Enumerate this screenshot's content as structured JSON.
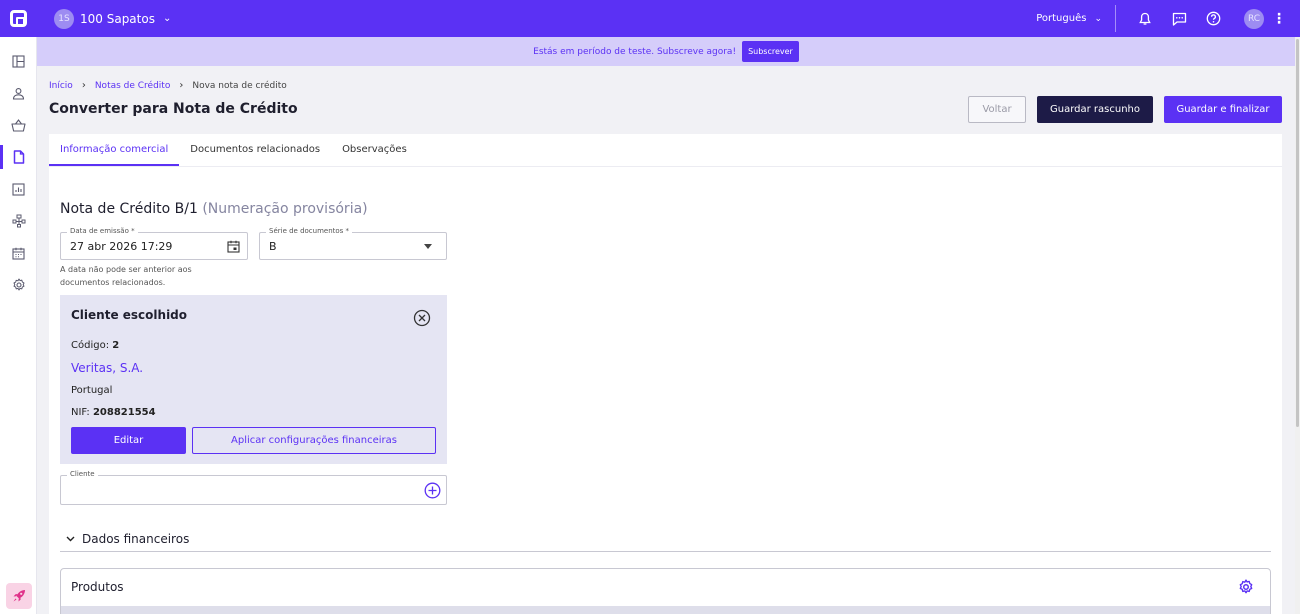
{
  "topbar": {
    "company_initials": "1S",
    "company_name": "100 Sapatos",
    "language": "Português",
    "user_initials": "RC"
  },
  "banner": {
    "text": "Estás em período de teste. Subscreve agora!",
    "button": "Subscrever"
  },
  "breadcrumb": {
    "home": "Início",
    "parent": "Notas de Crédito",
    "current": "Nova nota de crédito"
  },
  "page": {
    "title": "Converter para Nota de Crédito",
    "back_label": "Voltar",
    "draft_label": "Guardar rascunho",
    "finalize_label": "Guardar e finalizar"
  },
  "tabs": [
    {
      "label": "Informação comercial",
      "active": true
    },
    {
      "label": "Documentos relacionados",
      "active": false
    },
    {
      "label": "Observações",
      "active": false
    }
  ],
  "document": {
    "title": "Nota de Crédito B/1",
    "title_note": "(Numeração provisória)",
    "date_label": "Data de emissão *",
    "date_value": "27 abr 2026 17:29",
    "date_hint": "A data não pode ser anterior aos documentos relacionados.",
    "series_label": "Série de documentos *",
    "series_value": "B"
  },
  "client_box": {
    "title": "Cliente escolhido",
    "code_label": "Código:",
    "code_value": "2",
    "name": "Veritas, S.A.",
    "country": "Portugal",
    "nif_label": "NIF:",
    "nif_value": "208821554",
    "edit_label": "Editar",
    "apply_label": "Aplicar configurações financeiras"
  },
  "client_field": {
    "label": "Cliente",
    "value": ""
  },
  "financial": {
    "label": "Dados financeiros"
  },
  "products": {
    "label": "Produtos"
  },
  "colors": {
    "accent": "#5b31f4",
    "dark_button": "#1d1b47",
    "banner_bg": "#d5cdfa",
    "client_box_bg": "#e5e5f3"
  },
  "sidebar_icons": [
    "dashboard-icon",
    "user-icon",
    "basket-icon",
    "document-icon",
    "reports-icon",
    "hierarchy-icon",
    "calendar-icon",
    "settings-icon"
  ]
}
